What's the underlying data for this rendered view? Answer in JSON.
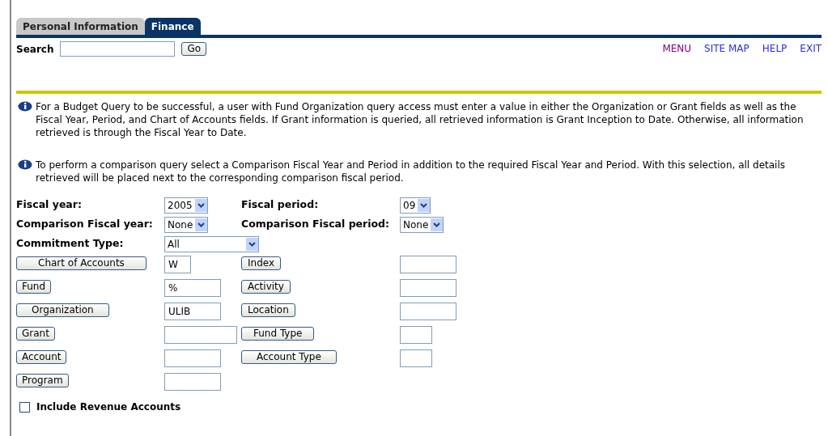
{
  "tabs": [
    {
      "label": "Personal Information",
      "selected": false
    },
    {
      "label": "Finance",
      "selected": true
    }
  ],
  "search": {
    "label": "Search",
    "button": "Go"
  },
  "top_links": [
    {
      "label": "MENU",
      "visited": true
    },
    {
      "label": "SITE MAP",
      "visited": false
    },
    {
      "label": "HELP",
      "visited": false
    },
    {
      "label": "EXIT",
      "visited": false
    }
  ],
  "info_messages": [
    "For a Budget Query to be successful, a user with Fund Organization query access must enter a value in either the Organization or Grant fields as well as the Fiscal Year, Period, and Chart of Accounts fields. If Grant information is queried, all retrieved information is Grant Inception to Date. Otherwise, all information retrieved is through the Fiscal Year to Date.",
    "To perform a comparison query select a Comparison Fiscal Year and Period in addition to the required Fiscal Year and Period. With this selection, all details retrieved will be placed next to the corresponding comparison fiscal period."
  ],
  "select_rows": [
    {
      "items": [
        {
          "label": "Fiscal year:",
          "value": "2005"
        },
        {
          "label": "Fiscal period:",
          "value": "09"
        }
      ]
    },
    {
      "items": [
        {
          "label": "Comparison Fiscal year:",
          "value": "None"
        },
        {
          "label": "Comparison Fiscal period:",
          "value": "None"
        }
      ]
    },
    {
      "items": [
        {
          "label": "Commitment Type:",
          "value": "All"
        }
      ]
    }
  ],
  "lookup_rows": [
    {
      "items": [
        {
          "button": "Chart of Accounts",
          "value": "W"
        },
        {
          "button": "Index"
        }
      ]
    },
    {
      "items": [
        {
          "button": "Fund",
          "value": "%"
        },
        {
          "button": "Activity"
        }
      ]
    },
    {
      "items": [
        {
          "button": "Organization",
          "value": "ULIB"
        },
        {
          "button": "Location"
        }
      ]
    },
    {
      "items": [
        {
          "button": "Grant"
        },
        {
          "button": "Fund Type"
        }
      ]
    },
    {
      "items": [
        {
          "button": "Account"
        },
        {
          "button": "Account Type"
        }
      ]
    },
    {
      "items": [
        {
          "button": "Program"
        }
      ]
    }
  ],
  "checkbox": {
    "label": "Include Revenue Accounts",
    "checked": false
  }
}
